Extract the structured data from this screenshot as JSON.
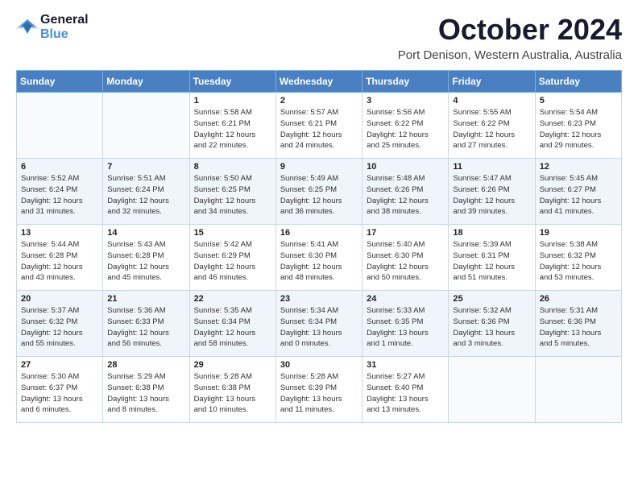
{
  "header": {
    "logo_line1": "General",
    "logo_line2": "Blue",
    "month_title": "October 2024",
    "location": "Port Denison, Western Australia, Australia"
  },
  "weekdays": [
    "Sunday",
    "Monday",
    "Tuesday",
    "Wednesday",
    "Thursday",
    "Friday",
    "Saturday"
  ],
  "weeks": [
    [
      {
        "day": "",
        "info": ""
      },
      {
        "day": "",
        "info": ""
      },
      {
        "day": "1",
        "info": "Sunrise: 5:58 AM\nSunset: 6:21 PM\nDaylight: 12 hours\nand 22 minutes."
      },
      {
        "day": "2",
        "info": "Sunrise: 5:57 AM\nSunset: 6:21 PM\nDaylight: 12 hours\nand 24 minutes."
      },
      {
        "day": "3",
        "info": "Sunrise: 5:56 AM\nSunset: 6:22 PM\nDaylight: 12 hours\nand 25 minutes."
      },
      {
        "day": "4",
        "info": "Sunrise: 5:55 AM\nSunset: 6:22 PM\nDaylight: 12 hours\nand 27 minutes."
      },
      {
        "day": "5",
        "info": "Sunrise: 5:54 AM\nSunset: 6:23 PM\nDaylight: 12 hours\nand 29 minutes."
      }
    ],
    [
      {
        "day": "6",
        "info": "Sunrise: 5:52 AM\nSunset: 6:24 PM\nDaylight: 12 hours\nand 31 minutes."
      },
      {
        "day": "7",
        "info": "Sunrise: 5:51 AM\nSunset: 6:24 PM\nDaylight: 12 hours\nand 32 minutes."
      },
      {
        "day": "8",
        "info": "Sunrise: 5:50 AM\nSunset: 6:25 PM\nDaylight: 12 hours\nand 34 minutes."
      },
      {
        "day": "9",
        "info": "Sunrise: 5:49 AM\nSunset: 6:25 PM\nDaylight: 12 hours\nand 36 minutes."
      },
      {
        "day": "10",
        "info": "Sunrise: 5:48 AM\nSunset: 6:26 PM\nDaylight: 12 hours\nand 38 minutes."
      },
      {
        "day": "11",
        "info": "Sunrise: 5:47 AM\nSunset: 6:26 PM\nDaylight: 12 hours\nand 39 minutes."
      },
      {
        "day": "12",
        "info": "Sunrise: 5:45 AM\nSunset: 6:27 PM\nDaylight: 12 hours\nand 41 minutes."
      }
    ],
    [
      {
        "day": "13",
        "info": "Sunrise: 5:44 AM\nSunset: 6:28 PM\nDaylight: 12 hours\nand 43 minutes."
      },
      {
        "day": "14",
        "info": "Sunrise: 5:43 AM\nSunset: 6:28 PM\nDaylight: 12 hours\nand 45 minutes."
      },
      {
        "day": "15",
        "info": "Sunrise: 5:42 AM\nSunset: 6:29 PM\nDaylight: 12 hours\nand 46 minutes."
      },
      {
        "day": "16",
        "info": "Sunrise: 5:41 AM\nSunset: 6:30 PM\nDaylight: 12 hours\nand 48 minutes."
      },
      {
        "day": "17",
        "info": "Sunrise: 5:40 AM\nSunset: 6:30 PM\nDaylight: 12 hours\nand 50 minutes."
      },
      {
        "day": "18",
        "info": "Sunrise: 5:39 AM\nSunset: 6:31 PM\nDaylight: 12 hours\nand 51 minutes."
      },
      {
        "day": "19",
        "info": "Sunrise: 5:38 AM\nSunset: 6:32 PM\nDaylight: 12 hours\nand 53 minutes."
      }
    ],
    [
      {
        "day": "20",
        "info": "Sunrise: 5:37 AM\nSunset: 6:32 PM\nDaylight: 12 hours\nand 55 minutes."
      },
      {
        "day": "21",
        "info": "Sunrise: 5:36 AM\nSunset: 6:33 PM\nDaylight: 12 hours\nand 56 minutes."
      },
      {
        "day": "22",
        "info": "Sunrise: 5:35 AM\nSunset: 6:34 PM\nDaylight: 12 hours\nand 58 minutes."
      },
      {
        "day": "23",
        "info": "Sunrise: 5:34 AM\nSunset: 6:34 PM\nDaylight: 13 hours\nand 0 minutes."
      },
      {
        "day": "24",
        "info": "Sunrise: 5:33 AM\nSunset: 6:35 PM\nDaylight: 13 hours\nand 1 minute."
      },
      {
        "day": "25",
        "info": "Sunrise: 5:32 AM\nSunset: 6:36 PM\nDaylight: 13 hours\nand 3 minutes."
      },
      {
        "day": "26",
        "info": "Sunrise: 5:31 AM\nSunset: 6:36 PM\nDaylight: 13 hours\nand 5 minutes."
      }
    ],
    [
      {
        "day": "27",
        "info": "Sunrise: 5:30 AM\nSunset: 6:37 PM\nDaylight: 13 hours\nand 6 minutes."
      },
      {
        "day": "28",
        "info": "Sunrise: 5:29 AM\nSunset: 6:38 PM\nDaylight: 13 hours\nand 8 minutes."
      },
      {
        "day": "29",
        "info": "Sunrise: 5:28 AM\nSunset: 6:38 PM\nDaylight: 13 hours\nand 10 minutes."
      },
      {
        "day": "30",
        "info": "Sunrise: 5:28 AM\nSunset: 6:39 PM\nDaylight: 13 hours\nand 11 minutes."
      },
      {
        "day": "31",
        "info": "Sunrise: 5:27 AM\nSunset: 6:40 PM\nDaylight: 13 hours\nand 13 minutes."
      },
      {
        "day": "",
        "info": ""
      },
      {
        "day": "",
        "info": ""
      }
    ]
  ]
}
